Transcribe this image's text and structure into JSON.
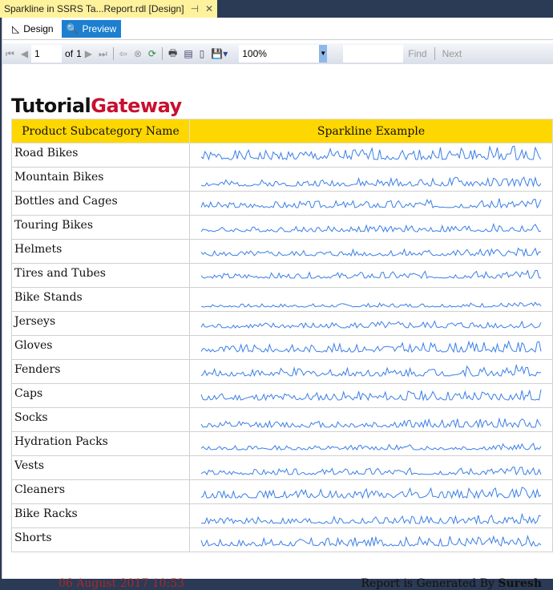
{
  "tab": {
    "title": "Sparkline in SSRS Ta...Report.rdl [Design]",
    "pin": "⊣",
    "close": "✕"
  },
  "modes": {
    "design": "Design",
    "preview": "Preview"
  },
  "toolbar": {
    "page": "1",
    "of": "of",
    "total": "1",
    "zoom": "100%",
    "find": "Find",
    "next": "Next"
  },
  "logo": {
    "part1": "Tutorial",
    "part2": "Gateway"
  },
  "table": {
    "headers": [
      "Product Subcategory Name",
      "Sparkline Example"
    ],
    "rows": [
      {
        "name": "Road Bikes",
        "seed": 1,
        "amp": 0.9,
        "base": 0.3
      },
      {
        "name": "Mountain Bikes",
        "seed": 2,
        "amp": 0.6,
        "base": 0.15
      },
      {
        "name": "Bottles and Cages",
        "seed": 3,
        "amp": 0.6,
        "base": 0.3
      },
      {
        "name": "Touring Bikes",
        "seed": 4,
        "amp": 0.5,
        "base": 0.3
      },
      {
        "name": "Helmets",
        "seed": 5,
        "amp": 0.5,
        "base": 0.3
      },
      {
        "name": "Tires and Tubes",
        "seed": 6,
        "amp": 0.5,
        "base": 0.4
      },
      {
        "name": "Bike Stands",
        "seed": 7,
        "amp": 0.3,
        "base": 0.1
      },
      {
        "name": "Jerseys",
        "seed": 8,
        "amp": 0.5,
        "base": 0.3
      },
      {
        "name": "Gloves",
        "seed": 9,
        "amp": 0.7,
        "base": 0.3
      },
      {
        "name": "Fenders",
        "seed": 10,
        "amp": 0.7,
        "base": 0.3
      },
      {
        "name": "Caps",
        "seed": 11,
        "amp": 0.7,
        "base": 0.3
      },
      {
        "name": "Socks",
        "seed": 12,
        "amp": 0.6,
        "base": 0.1
      },
      {
        "name": "Hydration Packs",
        "seed": 13,
        "amp": 0.4,
        "base": 0.2
      },
      {
        "name": "Vests",
        "seed": 14,
        "amp": 0.5,
        "base": 0.15
      },
      {
        "name": "Cleaners",
        "seed": 15,
        "amp": 0.7,
        "base": 0.2
      },
      {
        "name": "Bike Racks",
        "seed": 16,
        "amp": 0.6,
        "base": 0.1
      },
      {
        "name": "Shorts",
        "seed": 17,
        "amp": 0.7,
        "base": 0.2
      }
    ]
  },
  "footer": {
    "date": "06 August 2017 10:53",
    "generated": "Report is Generated By ",
    "user": "Suresh"
  },
  "colors": {
    "sparkline": "#3a7ee8",
    "header": "#ffd700"
  }
}
